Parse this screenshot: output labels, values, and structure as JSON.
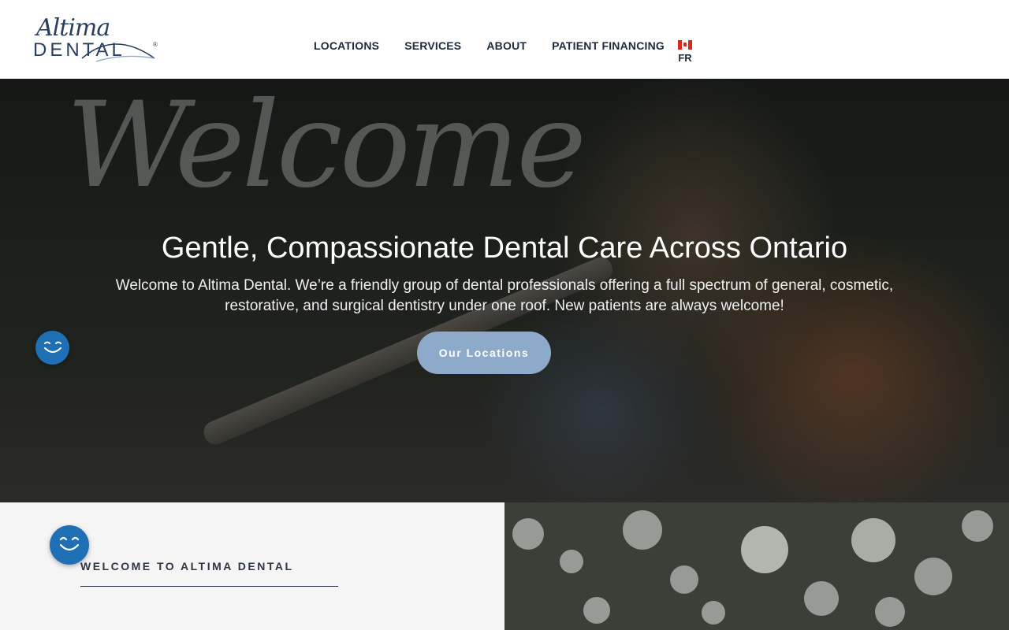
{
  "header": {
    "logo": {
      "script_text": "Altima",
      "word_text": "DENTAL",
      "reg_mark": "®"
    },
    "nav": [
      {
        "label": "LOCATIONS"
      },
      {
        "label": "SERVICES"
      },
      {
        "label": "ABOUT"
      },
      {
        "label": "PATIENT FINANCING"
      }
    ],
    "language": {
      "flag": "canada-flag-icon",
      "label": "FR"
    }
  },
  "hero": {
    "script_word": "Welcome",
    "title": "Gentle, Compassionate Dental Care Across Ontario",
    "text": "Welcome to Altima Dental. We’re a friendly group of dental professionals offering a full spectrum of general, cosmetic, restorative, and surgical dentistry under one roof. New patients are always welcome!",
    "button_label": "Our Locations",
    "button_color": "#8eaacb"
  },
  "widget": {
    "icon": "smile-icon",
    "color": "#1f6fb5"
  },
  "intro": {
    "heading": "WELCOME TO ALTIMA DENTAL"
  }
}
